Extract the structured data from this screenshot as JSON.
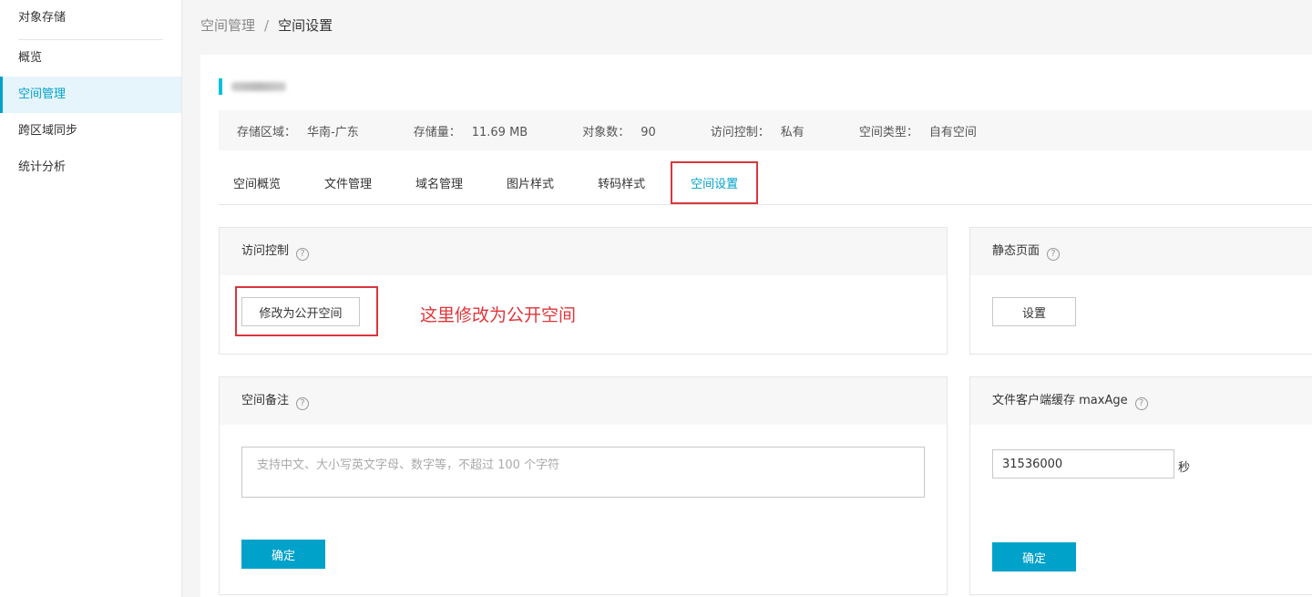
{
  "sidebar": {
    "title": "对象存储",
    "items": [
      {
        "label": "概览"
      },
      {
        "label": "空间管理"
      },
      {
        "label": "跨区域同步"
      },
      {
        "label": "统计分析"
      }
    ]
  },
  "breadcrumb": {
    "parent": "空间管理",
    "separator": "/",
    "current": "空间设置"
  },
  "info": {
    "region_label": "存储区域：",
    "region_value": "华南-广东",
    "storage_label": "存储量：",
    "storage_value": "11.69 MB",
    "objects_label": "对象数：",
    "objects_value": "90",
    "access_label": "访问控制：",
    "access_value": "私有",
    "type_label": "空间类型：",
    "type_value": "自有空间"
  },
  "tabs": [
    {
      "label": "空间概览"
    },
    {
      "label": "文件管理"
    },
    {
      "label": "域名管理"
    },
    {
      "label": "图片样式"
    },
    {
      "label": "转码样式"
    },
    {
      "label": "空间设置"
    }
  ],
  "access_card": {
    "title": "访问控制",
    "button": "修改为公开空间",
    "annotation": "这里修改为公开空间"
  },
  "static_card": {
    "title": "静态页面",
    "button": "设置"
  },
  "remark_card": {
    "title": "空间备注",
    "placeholder": "支持中文、大小写英文字母、数字等，不超过 100 个字符",
    "button": "确定"
  },
  "cache_card": {
    "title": "文件客户端缓存 maxAge",
    "value": "31536000",
    "unit": "秒",
    "button": "确定"
  },
  "help_glyph": "?",
  "colors": {
    "accent": "#00a2ca",
    "highlight": "#d9363e",
    "bucket_bar": "#00c1de"
  }
}
